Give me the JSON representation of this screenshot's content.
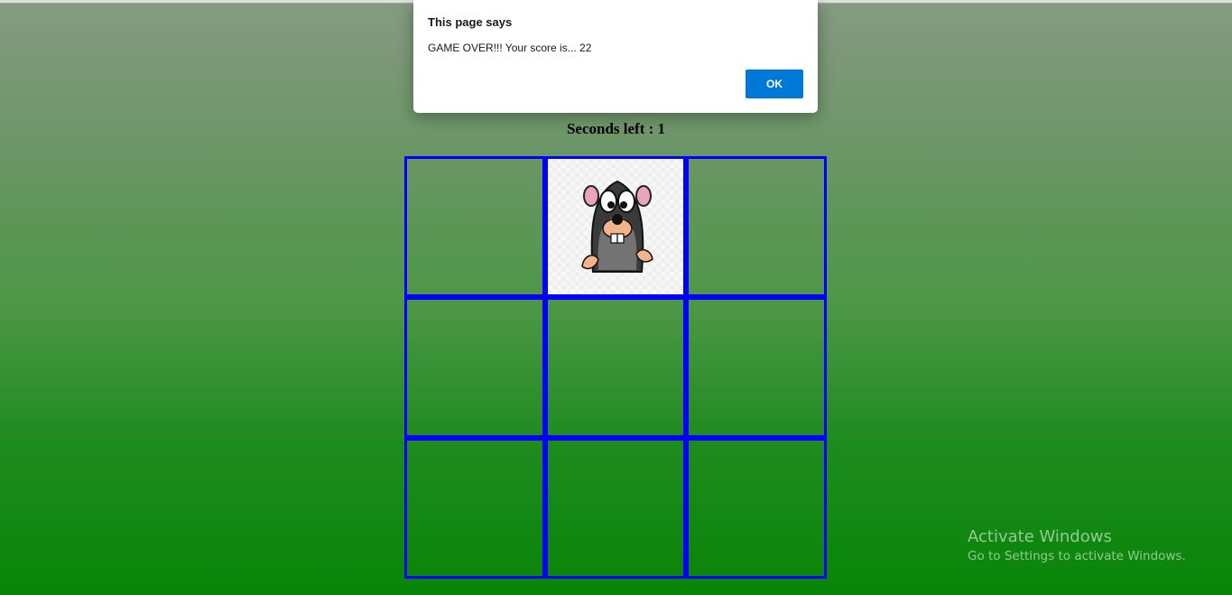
{
  "game": {
    "seconds_label": "Seconds left : 1",
    "grid": {
      "rows": 3,
      "cols": 3,
      "mole_cell_index": 1
    }
  },
  "dialog": {
    "title": "This page says",
    "message": "GAME OVER!!! Your score is... 22",
    "ok_label": "OK"
  },
  "watermark": {
    "title": "Activate Windows",
    "subtitle": "Go to Settings to activate Windows."
  },
  "colors": {
    "cell_border": "#0000ff",
    "ok_button": "#0078d7",
    "background_top": "#869a82",
    "background_bottom": "#078506"
  },
  "icons": {
    "mole": "mole-icon"
  }
}
